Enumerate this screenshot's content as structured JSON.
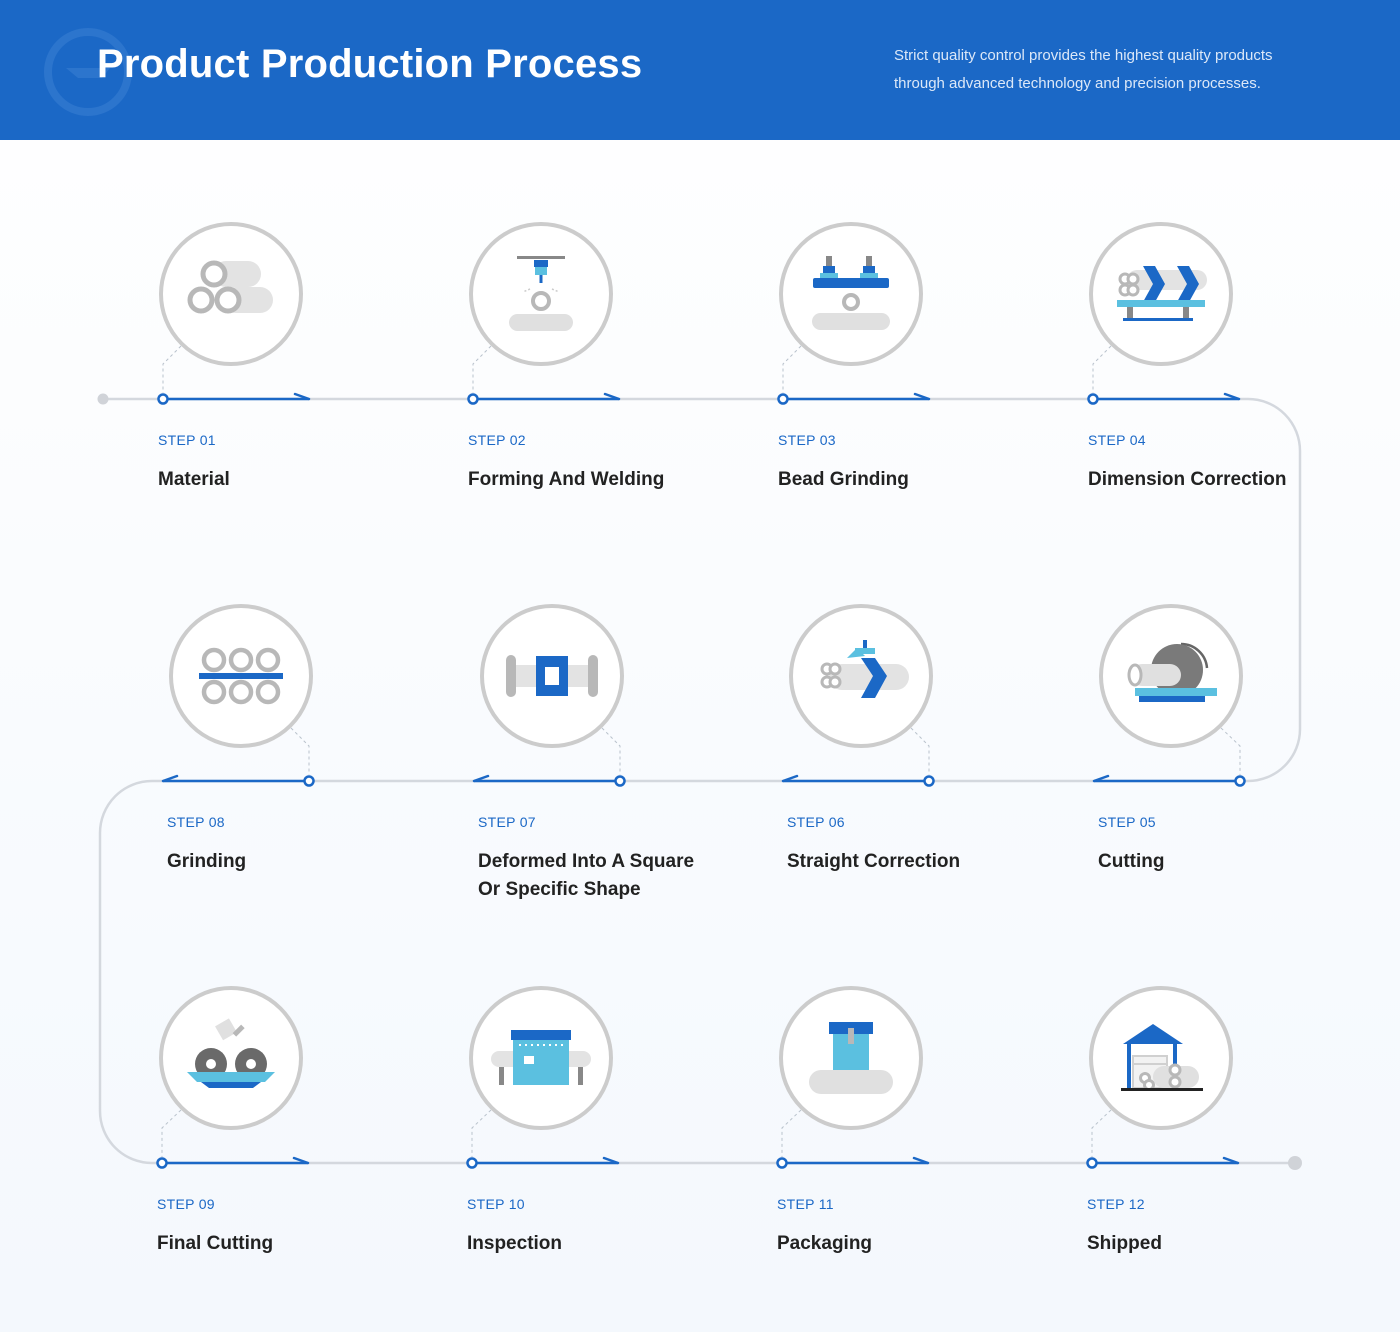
{
  "header": {
    "title": "Product Production Process",
    "subtitle_lines": [
      "Strict quality control provides the highest quality products",
      "through advanced technology and precision processes."
    ]
  },
  "colors": {
    "primary": "#1b68c6",
    "accent": "#5bc0e0",
    "line": "#d4d8de",
    "icon_gray": "#b8b8b8",
    "icon_light": "#e2e2e2",
    "text": "#222222"
  },
  "steps": [
    {
      "num": "STEP 01",
      "name": "Material",
      "icon": "pipe-stack-icon"
    },
    {
      "num": "STEP 02",
      "name": "Forming And Welding",
      "icon": "welding-torch-icon"
    },
    {
      "num": "STEP 03",
      "name": "Bead Grinding",
      "icon": "bead-grinder-icon"
    },
    {
      "num": "STEP 04",
      "name": "Dimension Correction",
      "icon": "sizing-rollers-icon"
    },
    {
      "num": "STEP 05",
      "name": "Cutting",
      "icon": "cutting-saw-icon"
    },
    {
      "num": "STEP 06",
      "name": "Straight Correction",
      "icon": "straightener-icon"
    },
    {
      "num": "STEP 07",
      "name": "Deformed Into A Square Or Specific Shape",
      "name_lines": [
        "Deformed Into A Square",
        "Or Specific Shape"
      ],
      "icon": "square-die-icon"
    },
    {
      "num": "STEP 08",
      "name": "Grinding",
      "icon": "pipe-bundle-icon"
    },
    {
      "num": "STEP 09",
      "name": "Final Cutting",
      "icon": "final-cutter-icon"
    },
    {
      "num": "STEP 10",
      "name": "Inspection",
      "icon": "inspection-machine-icon"
    },
    {
      "num": "STEP 11",
      "name": "Packaging",
      "icon": "package-box-icon"
    },
    {
      "num": "STEP 12",
      "name": "Shipped",
      "icon": "warehouse-icon"
    }
  ]
}
